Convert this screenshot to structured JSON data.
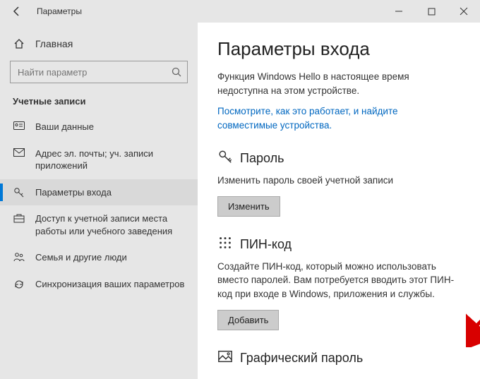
{
  "titlebar": {
    "title": "Параметры"
  },
  "home": {
    "label": "Главная"
  },
  "search": {
    "placeholder": "Найти параметр"
  },
  "sidebar": {
    "group_header": "Учетные записи",
    "items": [
      {
        "label": "Ваши данные"
      },
      {
        "label": "Адрес эл. почты; уч. записи приложений"
      },
      {
        "label": "Параметры входа"
      },
      {
        "label": "Доступ к учетной записи места работы или учебного заведения"
      },
      {
        "label": "Семья и другие люди"
      },
      {
        "label": "Синхронизация ваших параметров"
      }
    ]
  },
  "main": {
    "page_title": "Параметры входа",
    "hello_desc": "Функция Windows Hello в настоящее время недоступна на этом устройстве.",
    "hello_link": "Посмотрите, как это работает, и найдите совместимые устройства.",
    "password": {
      "title": "Пароль",
      "desc": "Изменить пароль своей учетной записи",
      "button": "Изменить"
    },
    "pin": {
      "title": "ПИН-код",
      "desc": "Создайте ПИН-код, который можно использовать вместо паролей. Вам потребуется вводить этот ПИН-код при входе в Windows, приложения и службы.",
      "button": "Добавить"
    },
    "picture": {
      "title": "Графический пароль"
    }
  }
}
